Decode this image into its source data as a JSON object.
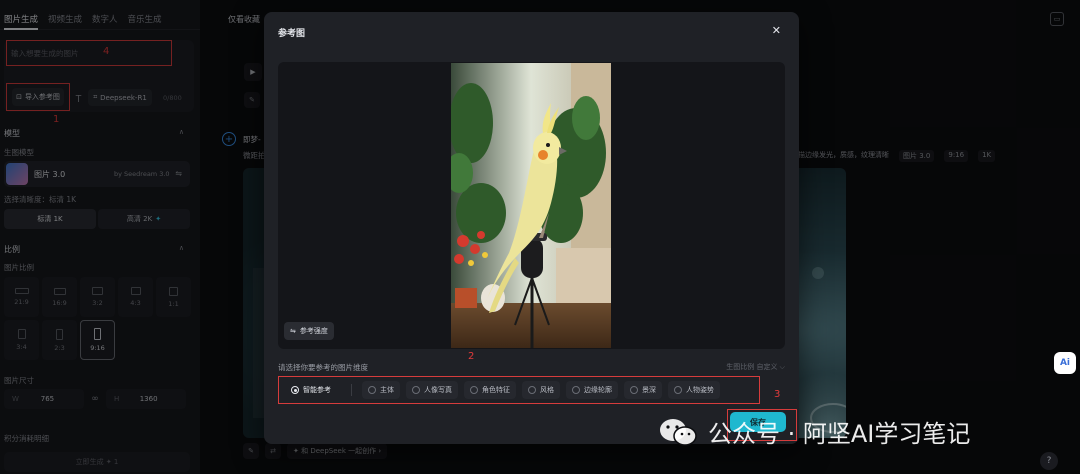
{
  "sidebar": {
    "tabs": [
      "图片生成",
      "视频生成",
      "数字人",
      "音乐生成"
    ],
    "prompt_placeholder": "输入想要生成的图片",
    "annotation_4": "4",
    "import_ref_label": "导入参考图",
    "annotation_1": "1",
    "deepseek_label": "Deepseek-R1",
    "char_counter": "0/800",
    "model_section": "模型",
    "gen_model_label": "生图模型",
    "model_name": "图片 3.0",
    "model_by": "by Seedream 3.0",
    "clarity_label": "选择清晰度：标清 1K",
    "res_options": [
      {
        "label": "标清 1K",
        "active": true,
        "plus": ""
      },
      {
        "label": "高清 2K",
        "active": false,
        "plus": "✦"
      }
    ],
    "ratio_section": "比例",
    "image_ratio_label": "图片比例",
    "ratios": [
      {
        "label": "21:9",
        "active": false
      },
      {
        "label": "16:9",
        "active": false
      },
      {
        "label": "3:2",
        "active": false
      },
      {
        "label": "4:3",
        "active": false
      },
      {
        "label": "1:1",
        "active": false
      },
      {
        "label": "3:4",
        "active": false
      },
      {
        "label": "2:3",
        "active": false
      },
      {
        "label": "9:16",
        "active": true
      }
    ],
    "image_size_label": "图片尺寸",
    "width_label": "W",
    "width_value": "765",
    "height_label": "H",
    "height_value": "1360",
    "points_label": "积分消耗明细",
    "generate_label": "立即生成 ✦ 1"
  },
  "main": {
    "fav_label": "仅看收藏",
    "record_author": "即梦-",
    "record_desc": "微距拍",
    "record_tail": "描边缘发光，质感，纹理清晰",
    "record_tags": [
      "图片 3.0",
      "9:16",
      "1K"
    ],
    "bottom_chip": "✦ 和 DeepSeek 一起创作 ›"
  },
  "modal": {
    "title": "参考图",
    "close": "✕",
    "strength_label": "参考强度",
    "annotation_2": "2",
    "dimension_prompt": "请选择你要参考的图片维度",
    "ratio_hint": "生图比例 自定义 ⌵",
    "smart_ref": "智能参考",
    "dimensions": [
      "主体",
      "人像写真",
      "角色特征",
      "风格",
      "边缘轮廓",
      "景深",
      "人物姿势"
    ],
    "annotation_3": "3",
    "confirm": "保存"
  },
  "watermark": {
    "text": "公众号 · 阿坚AI学习笔记"
  },
  "ai_badge": "Ai",
  "help": "?"
}
